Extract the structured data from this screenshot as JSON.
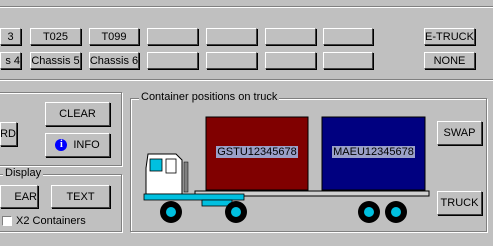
{
  "truck_row": [
    "3",
    "T025",
    "T099",
    "",
    "",
    "",
    ""
  ],
  "chassis_row": [
    "s 4",
    "Chassis 5",
    "Chassis 6",
    "",
    "",
    "",
    ""
  ],
  "right_buttons": {
    "etruck": "E-TRUCK",
    "none": "NONE"
  },
  "left_panel": {
    "clear": "CLEAR",
    "rd": "RD",
    "info": "INFO"
  },
  "display_group": {
    "title": "Display",
    "clear": "EAR",
    "text": "TEXT",
    "checkbox_label": "X2 Containers",
    "checkbox_checked": false
  },
  "positions_group": {
    "title": "Container positions on truck",
    "container1": {
      "id": "GSTU12345678",
      "color": "#800000"
    },
    "container2": {
      "id": "MAEU12345678",
      "color": "#000080"
    },
    "swap": "SWAP",
    "truck": "TRUCK"
  }
}
